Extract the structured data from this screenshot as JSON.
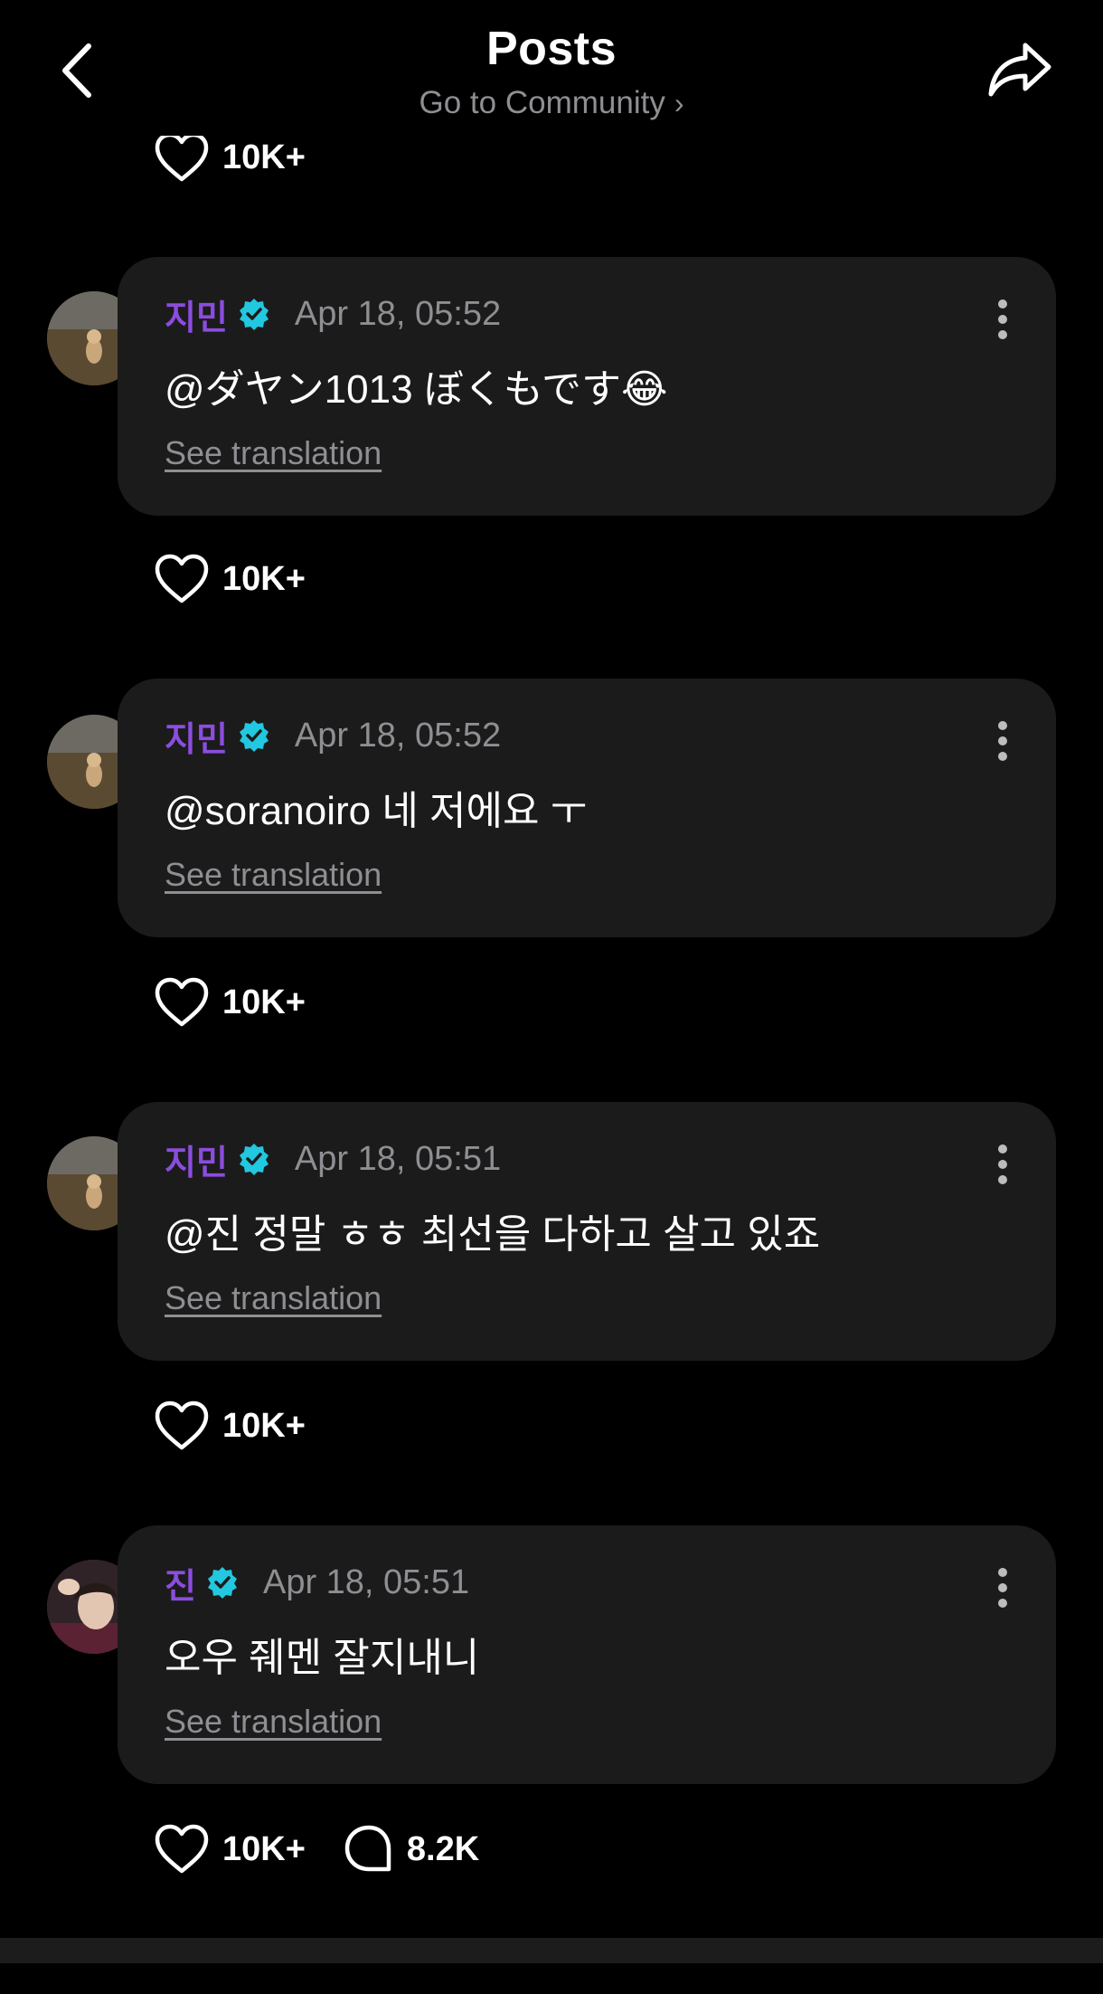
{
  "header": {
    "title": "Posts",
    "subtitle": "Go to Community",
    "subtitle_chevron": "›"
  },
  "top_stat": {
    "likes": "10K+"
  },
  "comments": [
    {
      "author": "지민",
      "time": "Apr 18, 05:52",
      "text": "@ダヤン1013 ぼくもです😂",
      "translate": "See translation",
      "likes": "10K+"
    },
    {
      "author": "지민",
      "time": "Apr 18, 05:52",
      "text": "@soranoiro 네 저에요 ㅜ",
      "translate": "See translation",
      "likes": "10K+"
    },
    {
      "author": "지민",
      "time": "Apr 18, 05:51",
      "text": "@진 정말 ㅎㅎ 최선을 다하고 살고 있죠",
      "translate": "See translation",
      "likes": "10K+"
    },
    {
      "author": "진",
      "time": "Apr 18, 05:51",
      "text": "오우 줴멘 잘지내니",
      "translate": "See translation",
      "likes": "10K+",
      "replies": "8.2K"
    }
  ],
  "colors": {
    "author": "#8b4dde",
    "verified": "#22c7e0",
    "muted": "#8e8e93",
    "card": "#1b1b1b",
    "background": "#000000"
  },
  "icons": {
    "back": "chevron-left-icon",
    "share": "share-icon",
    "like": "heart-icon",
    "reply": "comment-bubble-icon",
    "verified": "verified-badge-icon",
    "more": "more-vertical-icon"
  }
}
